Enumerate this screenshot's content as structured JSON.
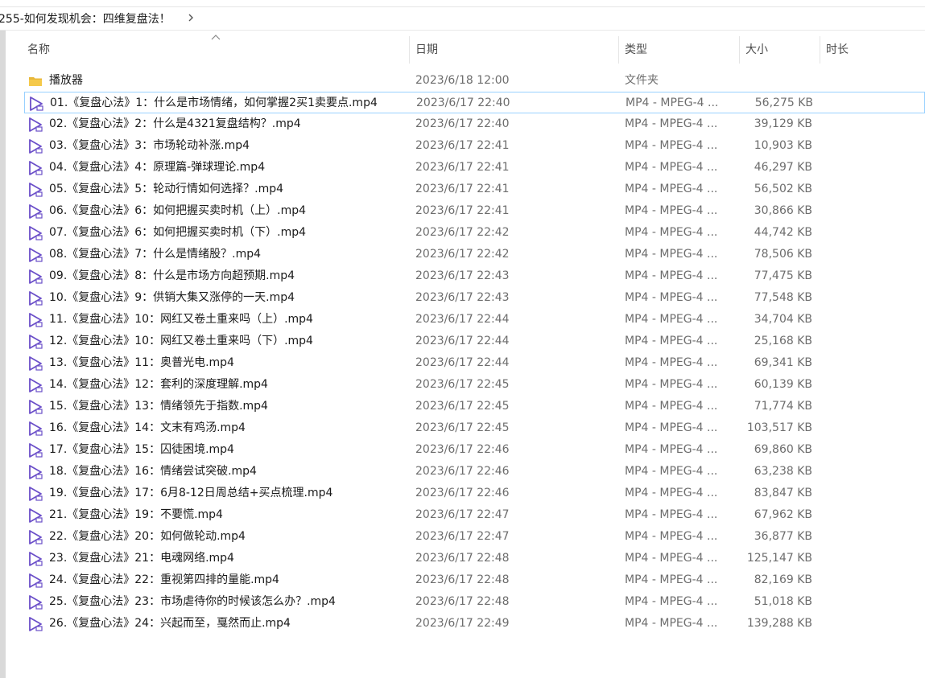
{
  "breadcrumb": {
    "path": "255-如何发现机会：四维复盘法！"
  },
  "columns": {
    "name": "名称",
    "date": "日期",
    "type": "类型",
    "size": "大小",
    "duration": "时长"
  },
  "folder": {
    "name": "播放器",
    "date": "2023/6/18 12:00",
    "type": "文件夹",
    "size": ""
  },
  "files": [
    {
      "name": "01.《复盘心法》1：什么是市场情绪，如何掌握2买1卖要点.mp4",
      "date": "2023/6/17 22:40",
      "type": "MP4 - MPEG-4 ...",
      "size": "56,275 KB"
    },
    {
      "name": "02.《复盘心法》2：什么是4321复盘结构？.mp4",
      "date": "2023/6/17 22:40",
      "type": "MP4 - MPEG-4 ...",
      "size": "39,129 KB"
    },
    {
      "name": "03.《复盘心法》3：市场轮动补涨.mp4",
      "date": "2023/6/17 22:41",
      "type": "MP4 - MPEG-4 ...",
      "size": "10,903 KB"
    },
    {
      "name": "04.《复盘心法》4：原理篇-弹球理论.mp4",
      "date": "2023/6/17 22:41",
      "type": "MP4 - MPEG-4 ...",
      "size": "46,297 KB"
    },
    {
      "name": "05.《复盘心法》5：轮动行情如何选择？.mp4",
      "date": "2023/6/17 22:41",
      "type": "MP4 - MPEG-4 ...",
      "size": "56,502 KB"
    },
    {
      "name": "06.《复盘心法》6：如何把握买卖时机（上）.mp4",
      "date": "2023/6/17 22:41",
      "type": "MP4 - MPEG-4 ...",
      "size": "30,866 KB"
    },
    {
      "name": "07.《复盘心法》6：如何把握买卖时机（下）.mp4",
      "date": "2023/6/17 22:42",
      "type": "MP4 - MPEG-4 ...",
      "size": "44,742 KB"
    },
    {
      "name": "08.《复盘心法》7：什么是情绪股？.mp4",
      "date": "2023/6/17 22:42",
      "type": "MP4 - MPEG-4 ...",
      "size": "78,506 KB"
    },
    {
      "name": "09.《复盘心法》8：什么是市场方向超预期.mp4",
      "date": "2023/6/17 22:43",
      "type": "MP4 - MPEG-4 ...",
      "size": "77,475 KB"
    },
    {
      "name": "10.《复盘心法》9：供销大集又涨停的一天.mp4",
      "date": "2023/6/17 22:43",
      "type": "MP4 - MPEG-4 ...",
      "size": "77,548 KB"
    },
    {
      "name": "11.《复盘心法》10：网红又卷土重来吗（上）.mp4",
      "date": "2023/6/17 22:44",
      "type": "MP4 - MPEG-4 ...",
      "size": "34,704 KB"
    },
    {
      "name": "12.《复盘心法》10：网红又卷土重来吗（下）.mp4",
      "date": "2023/6/17 22:44",
      "type": "MP4 - MPEG-4 ...",
      "size": "25,168 KB"
    },
    {
      "name": "13.《复盘心法》11：奥普光电.mp4",
      "date": "2023/6/17 22:44",
      "type": "MP4 - MPEG-4 ...",
      "size": "69,341 KB"
    },
    {
      "name": "14.《复盘心法》12：套利的深度理解.mp4",
      "date": "2023/6/17 22:45",
      "type": "MP4 - MPEG-4 ...",
      "size": "60,139 KB"
    },
    {
      "name": "15.《复盘心法》13：情绪领先于指数.mp4",
      "date": "2023/6/17 22:45",
      "type": "MP4 - MPEG-4 ...",
      "size": "71,774 KB"
    },
    {
      "name": "16.《复盘心法》14：文末有鸡汤.mp4",
      "date": "2023/6/17 22:45",
      "type": "MP4 - MPEG-4 ...",
      "size": "103,517 KB"
    },
    {
      "name": "17.《复盘心法》15：囚徒困境.mp4",
      "date": "2023/6/17 22:46",
      "type": "MP4 - MPEG-4 ...",
      "size": "69,860 KB"
    },
    {
      "name": "18.《复盘心法》16：情绪尝试突破.mp4",
      "date": "2023/6/17 22:46",
      "type": "MP4 - MPEG-4 ...",
      "size": "63,238 KB"
    },
    {
      "name": "19.《复盘心法》17：6月8-12日周总结+买点梳理.mp4",
      "date": "2023/6/17 22:46",
      "type": "MP4 - MPEG-4 ...",
      "size": "83,847 KB"
    },
    {
      "name": "21.《复盘心法》19：不要慌.mp4",
      "date": "2023/6/17 22:47",
      "type": "MP4 - MPEG-4 ...",
      "size": "67,962 KB"
    },
    {
      "name": "22.《复盘心法》20：如何做轮动.mp4",
      "date": "2023/6/17 22:47",
      "type": "MP4 - MPEG-4 ...",
      "size": "36,877 KB"
    },
    {
      "name": "23.《复盘心法》21：电魂网络.mp4",
      "date": "2023/6/17 22:48",
      "type": "MP4 - MPEG-4 ...",
      "size": "125,147 KB"
    },
    {
      "name": "24.《复盘心法》22：重视第四排的量能.mp4",
      "date": "2023/6/17 22:48",
      "type": "MP4 - MPEG-4 ...",
      "size": "82,169 KB"
    },
    {
      "name": "25.《复盘心法》23：市场虐待你的时候该怎么办？.mp4",
      "date": "2023/6/17 22:48",
      "type": "MP4 - MPEG-4 ...",
      "size": "51,018 KB"
    },
    {
      "name": "26.《复盘心法》24：兴起而至，戛然而止.mp4",
      "date": "2023/6/17 22:49",
      "type": "MP4 - MPEG-4 ...",
      "size": "139,288 KB"
    }
  ],
  "selected_index": 0,
  "icons": {
    "folder": "folder-icon",
    "video": "video-file-icon",
    "sort": "sort-ascending-icon",
    "chevron": "chevron-right-icon"
  },
  "colors": {
    "folder": "#e8b739",
    "video_icon": "#6b4fc9",
    "selection_border": "#99d1ff"
  }
}
